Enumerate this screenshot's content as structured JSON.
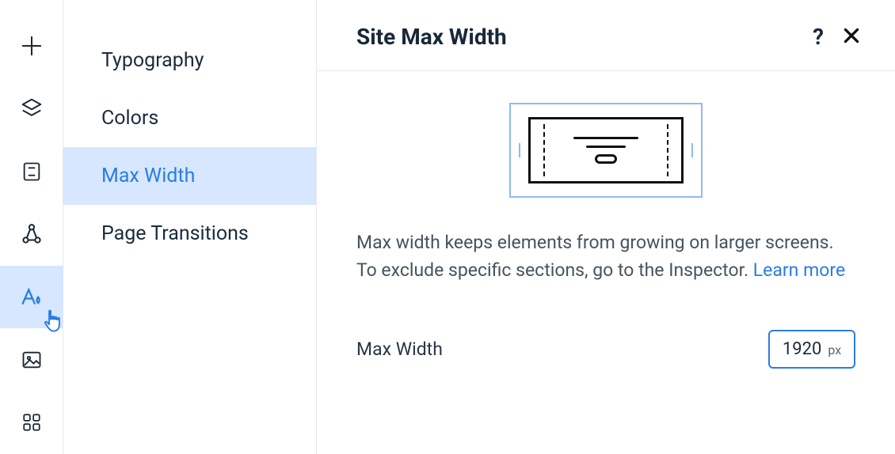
{
  "sidebar": {
    "items": [
      {
        "label": "Typography"
      },
      {
        "label": "Colors"
      },
      {
        "label": "Max Width"
      },
      {
        "label": "Page Transitions"
      }
    ]
  },
  "header": {
    "title": "Site Max Width",
    "help": "?"
  },
  "description": {
    "text": "Max width keeps elements from growing on larger screens. To exclude specific sections, go to the Inspector.",
    "learn_more": "Learn more"
  },
  "field": {
    "label": "Max Width",
    "value": "1920",
    "unit": "px"
  }
}
